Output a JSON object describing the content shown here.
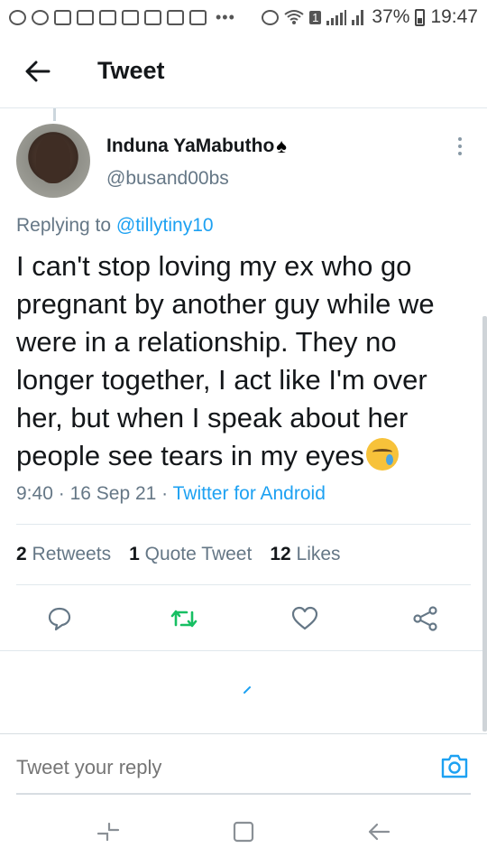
{
  "status_bar": {
    "battery": "37%",
    "time": "19:47",
    "sim": "1",
    "more": "•••"
  },
  "header": {
    "title": "Tweet",
    "back_icon": "arrow-left-icon"
  },
  "tweet": {
    "author_name": "Induna YaMabutho",
    "author_name_emoji": "♠",
    "author_handle": "@busand00bs",
    "replying_prefix": "Replying to",
    "replying_to": "@tillytiny10",
    "text": "I can't stop loving my ex who go pregnant by another guy while we were in a relationship. They no longer together, I act like I'm over her, but when I speak about her people see tears in my eyes",
    "text_emoji": "crying-face-emoji",
    "time": "9:40",
    "date": "16 Sep 21",
    "source": "Twitter for Android",
    "stats": {
      "retweets_count": "2",
      "retweets_label": "Retweets",
      "quotes_count": "1",
      "quotes_label": "Quote Tweet",
      "likes_count": "12",
      "likes_label": "Likes"
    }
  },
  "actions": [
    "reply-icon",
    "retweet-icon",
    "like-icon",
    "share-icon"
  ],
  "reply_bar": {
    "placeholder": "Tweet your reply",
    "camera_icon": "camera-icon"
  },
  "colors": {
    "accent": "#1da1f2",
    "retweet_green": "#17bf63",
    "secondary_text": "#657786",
    "divider": "#e1e8ed"
  }
}
